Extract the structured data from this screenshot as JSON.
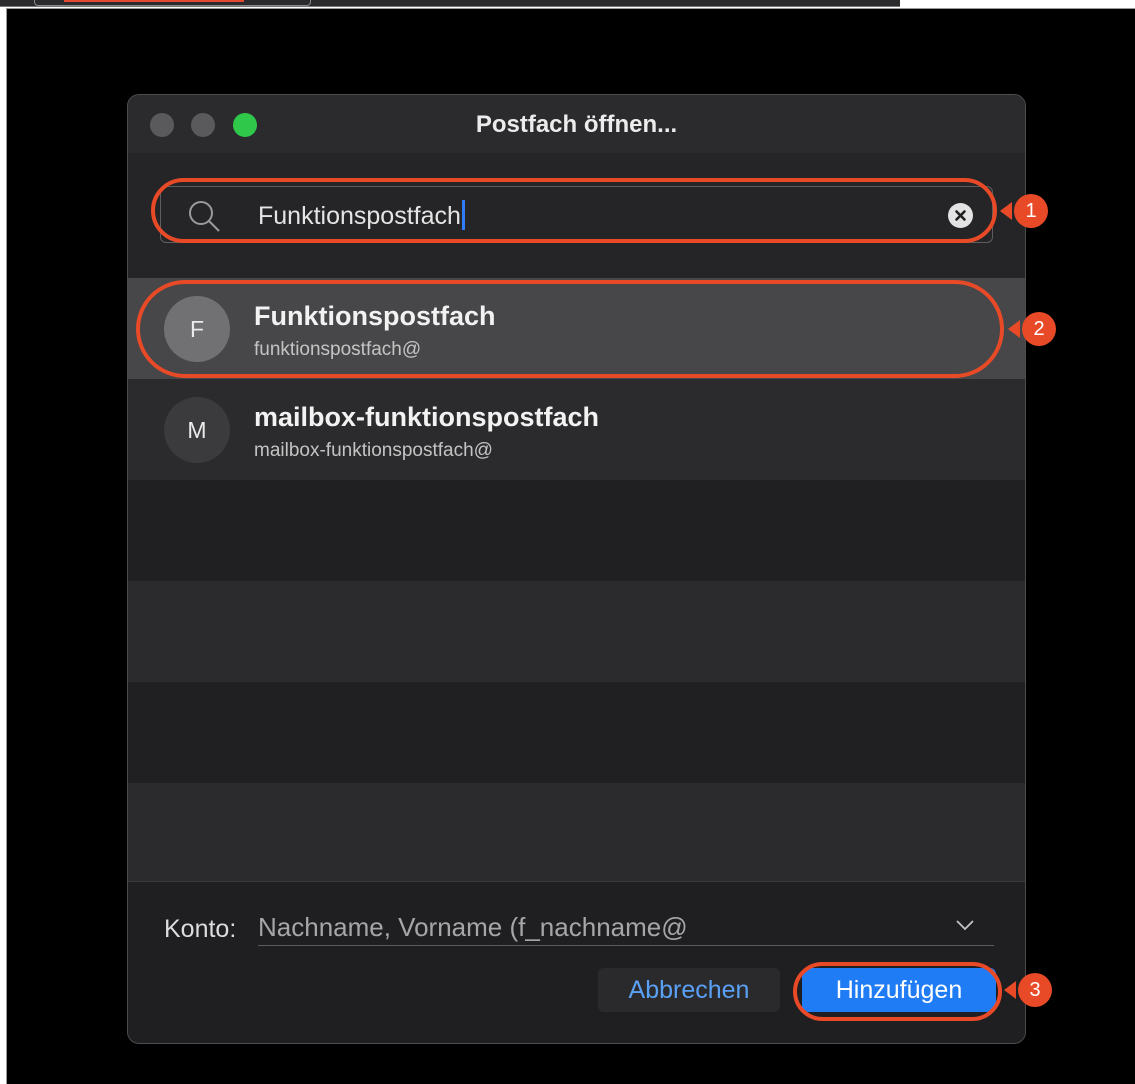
{
  "window": {
    "title": "Postfach öffnen...",
    "traffic_lights": [
      "#5a5a5c",
      "#5a5a5c",
      "#2fc84a"
    ]
  },
  "search": {
    "value": "Funktionspostfach",
    "icon": "search-icon",
    "clear_icon": "clear-icon"
  },
  "results": [
    {
      "initial": "F",
      "name": "Funktionspostfach",
      "email": "funktionspostfach@",
      "selected": true
    },
    {
      "initial": "M",
      "name": "mailbox-funktionspostfach",
      "email": "mailbox-funktionspostfach@",
      "selected": false
    }
  ],
  "footer": {
    "konto_label": "Konto:",
    "konto_value": "Nachname, Vorname (f_nachname@",
    "cancel_label": "Abbrechen",
    "add_label": "Hinzufügen"
  },
  "annotations": {
    "color": "#e84a28",
    "badges": [
      "1",
      "2",
      "3"
    ]
  }
}
